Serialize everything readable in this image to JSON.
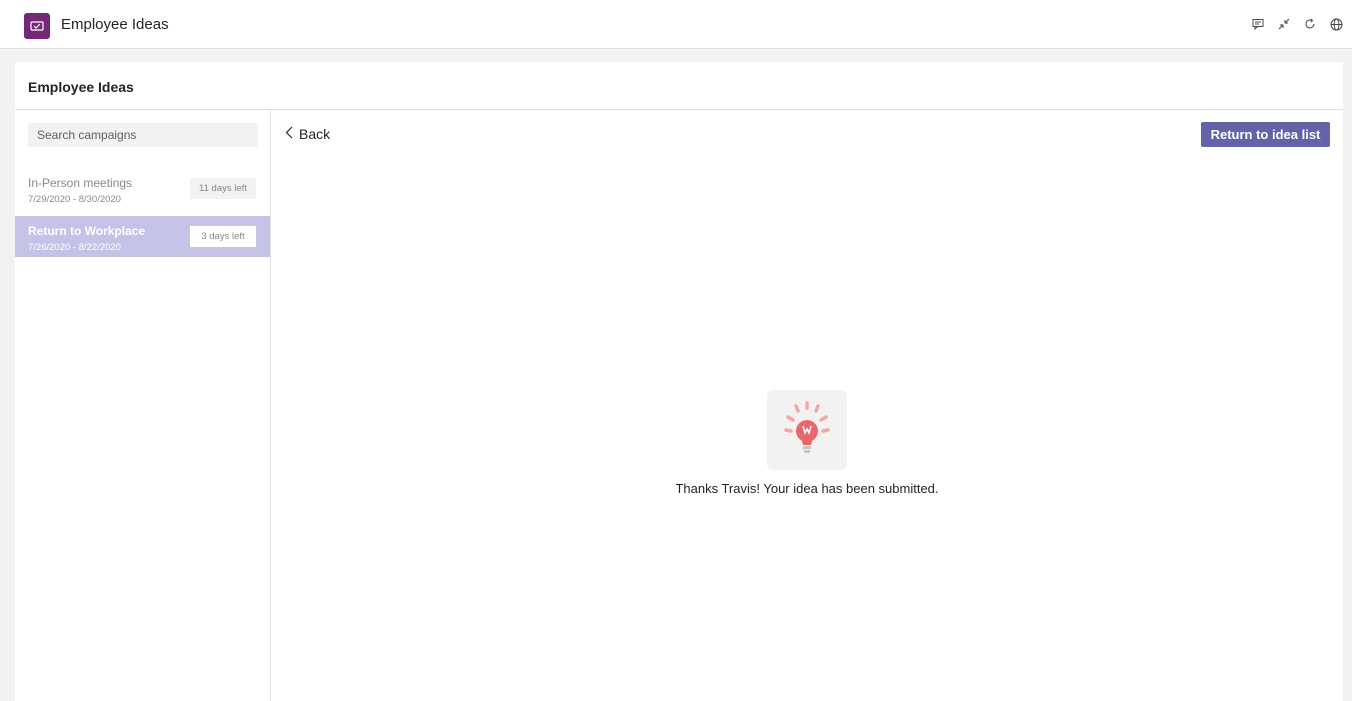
{
  "app": {
    "title": "Employee Ideas",
    "brand_color": "#742774",
    "icons": [
      "chat-icon",
      "collapse-icon",
      "refresh-icon",
      "globe-icon"
    ]
  },
  "card": {
    "title": "Employee Ideas"
  },
  "sidebar": {
    "search_placeholder": "Search campaigns",
    "campaigns": [
      {
        "name": "In-Person meetings",
        "dates": "7/29/2020 - 8/30/2020",
        "badge": "11 days left",
        "selected": false
      },
      {
        "name": "Return to Workplace",
        "dates": "7/26/2020 - 8/22/2020",
        "badge": "3 days left",
        "selected": true
      }
    ],
    "selected_color": "#c5c2e8"
  },
  "content": {
    "back_label": "Back",
    "primary_button": "Return to idea list",
    "primary_color": "#6264a7",
    "illustration_icon": "lightbulb-icon",
    "success_message": "Thanks Travis! Your idea has been submitted."
  }
}
